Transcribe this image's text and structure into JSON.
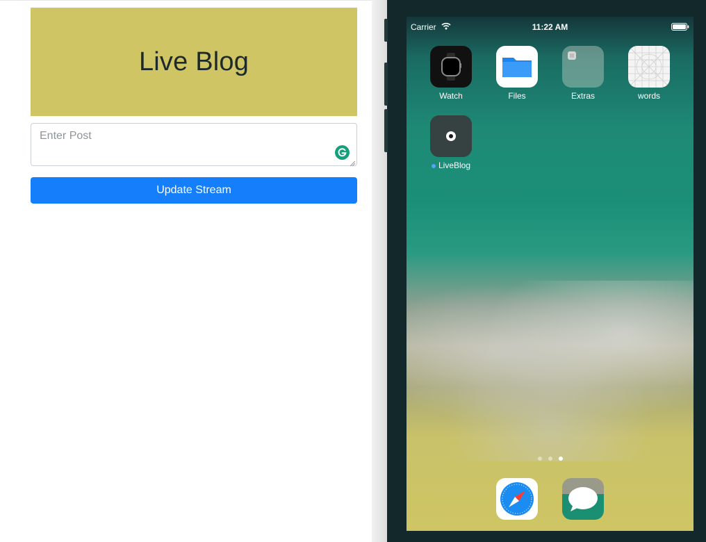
{
  "webpage": {
    "banner_title": "Live Blog",
    "post_placeholder": "Enter Post",
    "update_button_label": "Update Stream"
  },
  "simulator": {
    "status_bar": {
      "carrier": "Carrier",
      "time": "11:22 AM",
      "icons": [
        "wifi-icon",
        "battery-icon"
      ]
    },
    "apps": [
      {
        "label": "Watch",
        "icon": "watch-icon"
      },
      {
        "label": "Files",
        "icon": "folder-icon"
      },
      {
        "label": "Extras",
        "icon": "folder-icon"
      },
      {
        "label": "words",
        "icon": "grid-icon"
      },
      {
        "label": "LiveBlog",
        "icon": "record-icon",
        "new_badge": true
      }
    ],
    "page_dots": {
      "count": 3,
      "active_index": 2
    },
    "dock": [
      {
        "app": "Safari",
        "icon": "compass-icon"
      },
      {
        "app": "Messages",
        "icon": "speech-bubble-icon"
      }
    ]
  },
  "colors": {
    "banner": "#cfc564",
    "primary_button": "#157ffb",
    "simulator_frame": "#13282a",
    "grammar_icon": "#15a07d"
  }
}
